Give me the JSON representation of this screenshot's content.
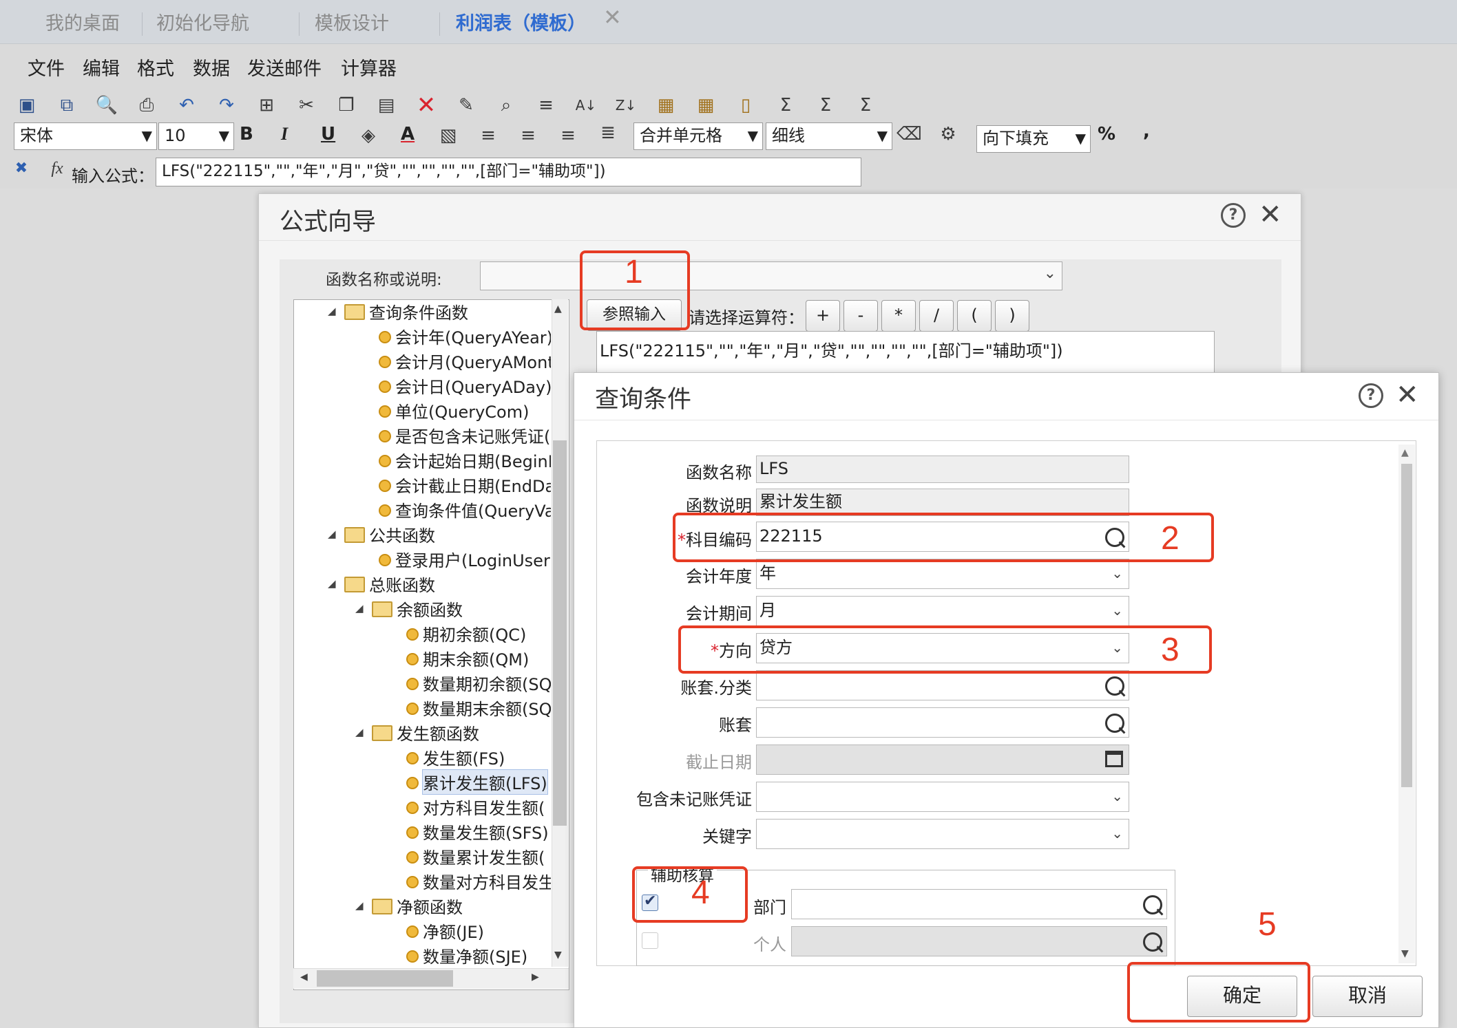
{
  "tabs": [
    {
      "label": "我的桌面"
    },
    {
      "label": "初始化导航"
    },
    {
      "label": "模板设计"
    },
    {
      "label": "利润表（模板）"
    }
  ],
  "menu": [
    "文件",
    "编辑",
    "格式",
    "数据",
    "发送邮件",
    "计算器"
  ],
  "toolbar": {
    "font_name": "宋体",
    "font_size": "10",
    "bold": "B",
    "italic": "I",
    "underline": "U",
    "font_color": "A",
    "merge": "合并单元格",
    "border": "细线",
    "fill": "向下填充",
    "percent": "%",
    "comma": ","
  },
  "formula_bar": {
    "label": "输入公式：",
    "value": "LFS(\"222115\",\"\",\"年\",\"月\",\"贷\",\"\",\"\",\"\",\"\",[部门=\"辅助项\"])"
  },
  "wizard": {
    "title": "公式向导",
    "func_label": "函数名称或说明:",
    "ref_input": "参照输入",
    "op_label": "请选择运算符：",
    "operators": [
      "+",
      "-",
      "*",
      "/",
      "(",
      ")"
    ],
    "formula": "LFS(\"222115\",\"\",\"年\",\"月\",\"贷\",\"\",\"\",\"\",\"\",[部门=\"辅助项\"])",
    "tree": [
      {
        "label": "查询条件函数",
        "type": "folder"
      },
      {
        "label": "会计年(QueryAYear)",
        "type": "leaf"
      },
      {
        "label": "会计月(QueryAMont",
        "type": "leaf"
      },
      {
        "label": "会计日(QueryADay)",
        "type": "leaf"
      },
      {
        "label": "单位(QueryCom)",
        "type": "leaf"
      },
      {
        "label": "是否包含未记账凭证(",
        "type": "leaf"
      },
      {
        "label": "会计起始日期(BeginI",
        "type": "leaf"
      },
      {
        "label": "会计截止日期(EndDa",
        "type": "leaf"
      },
      {
        "label": "查询条件值(QueryVa",
        "type": "leaf"
      },
      {
        "label": "公共函数",
        "type": "folder"
      },
      {
        "label": "登录用户(LoginUser",
        "type": "leaf"
      },
      {
        "label": "总账函数",
        "type": "folder"
      },
      {
        "label": "余额函数",
        "type": "folder"
      },
      {
        "label": "期初余额(QC)",
        "type": "leaf"
      },
      {
        "label": "期末余额(QM)",
        "type": "leaf"
      },
      {
        "label": "数量期初余额(SQ",
        "type": "leaf"
      },
      {
        "label": "数量期末余额(SQ",
        "type": "leaf"
      },
      {
        "label": "发生额函数",
        "type": "folder"
      },
      {
        "label": "发生额(FS)",
        "type": "leaf"
      },
      {
        "label": "累计发生额(LFS)",
        "type": "leaf"
      },
      {
        "label": "对方科目发生额(",
        "type": "leaf"
      },
      {
        "label": "数量发生额(SFS)",
        "type": "leaf"
      },
      {
        "label": "数量累计发生额(",
        "type": "leaf"
      },
      {
        "label": "数量对方科目发生",
        "type": "leaf"
      },
      {
        "label": "净额函数",
        "type": "folder"
      },
      {
        "label": "净额(JE)",
        "type": "leaf"
      },
      {
        "label": "数量净额(SJE)",
        "type": "leaf"
      }
    ]
  },
  "query": {
    "title": "查询条件",
    "fields": {
      "func_name_label": "函数名称",
      "func_name": "LFS",
      "func_desc_label": "函数说明",
      "func_desc": "累计发生额",
      "account_code_label": "科目编码",
      "account_code": "222115",
      "year_label": "会计年度",
      "year": "年",
      "period_label": "会计期间",
      "period": "月",
      "direction_label": "方向",
      "direction": "贷方",
      "book_category_label": "账套.分类",
      "book_label": "账套",
      "end_date_label": "截止日期",
      "include_unposted_label": "包含未记账凭证",
      "keyword_label": "关键字"
    },
    "aux": {
      "legend": "辅助核算",
      "dept_label": "部门",
      "person_label": "个人"
    },
    "required_mark": "*",
    "ok": "确定",
    "cancel": "取消"
  },
  "annotations": [
    "1",
    "2",
    "3",
    "4",
    "5"
  ],
  "colors": {
    "annotation_red": "#e63b23",
    "active_tab": "#2f6bd0"
  }
}
